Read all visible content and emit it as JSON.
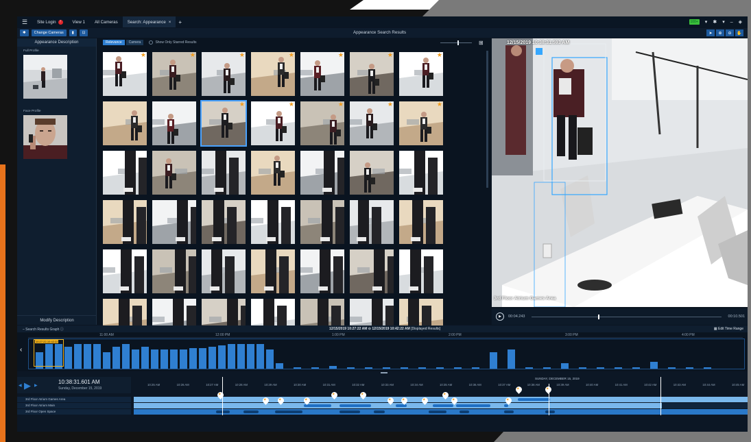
{
  "titlebar": {
    "tabs": [
      {
        "label": "Site Login",
        "badge": "!"
      },
      {
        "label": "View 1"
      },
      {
        "label": "All Cameras"
      },
      {
        "label": "Search: Appearance",
        "close": "×"
      }
    ],
    "add_tab": "+",
    "battery": "100+",
    "window_minimize": "–",
    "accent": "#2f7fd1"
  },
  "toolbar": {
    "change_cameras": "Change Cameras",
    "title": "Appearance Search Results"
  },
  "left_panel": {
    "header": "Appearance Description",
    "full_profile_label": "Full Profile",
    "face_profile_label": "Face Profile",
    "modify_button": "Modify Description"
  },
  "results": {
    "sort_relevance": "Relevance",
    "sort_camera": "Camera",
    "only_starred": "Show Only Starred Results",
    "grid_size": 0.55
  },
  "video": {
    "timestamp": "12/15/2019 10:38:31.593 AM",
    "camera_label": "3rd Floor Atrium Games Area",
    "position": "00:04.243",
    "duration": "00:10.501",
    "progress": 0.4
  },
  "graph": {
    "header": "Search Results Graph",
    "range": "12/15/2019 10:27:22 AM ⊙ 12/15/2019 10:42:22 AM",
    "range_note": "[Displayed Results]",
    "edit_range": "Edit Time Range",
    "axis_labels": [
      "11:00 AM",
      "12:00 PM",
      "1:00 PM",
      "2:00 PM",
      "3:00 PM",
      "4:00 PM"
    ],
    "selection_label": "10:27:22-10:42:22",
    "bar_levels": [
      0.6,
      0.9,
      0.9,
      0.8,
      0.9,
      0.9,
      0.9,
      0.6,
      0.8,
      0.9,
      0.7,
      0.8,
      0.7,
      0.7,
      0.7,
      0.7,
      0.75,
      0.75,
      0.8,
      0.85,
      0.9,
      0.9,
      0.9,
      0.9,
      0.7,
      0.2,
      0.05,
      0.05,
      0.1,
      0.05,
      0.05,
      0.05,
      0.05,
      0.05,
      0.05,
      0.05,
      0.05,
      0.6,
      0.7,
      0.05,
      0.05,
      0.2,
      0.05,
      0.05,
      0.05,
      0.05,
      0.25,
      0.05,
      0.05,
      0.05
    ]
  },
  "timeline": {
    "time": "10:38:31.601 AM",
    "date": "Sunday, December 15, 2019",
    "day_label": "SUNDAY, DECEMBER 15, 2019",
    "ticks": [
      "10:25 AM",
      "10:26 AM",
      "10:27 AM",
      "10:28 AM",
      "10:29 AM",
      "10:30 AM",
      "10:31 AM",
      "10:32 AM",
      "10:33 AM",
      "10:34 AM",
      "10:35 AM",
      "10:36 AM",
      "10:37 AM",
      "10:38 AM",
      "10:39 AM",
      "10:40 AM",
      "10:41 AM",
      "10:42 AM",
      "10:43 AM",
      "10:44 AM",
      "10:45 AM"
    ],
    "cameras": [
      "3rd Floor Atrium Games Area",
      "3rd Floor Atrium Main",
      "3rd Floor Open Space"
    ]
  }
}
